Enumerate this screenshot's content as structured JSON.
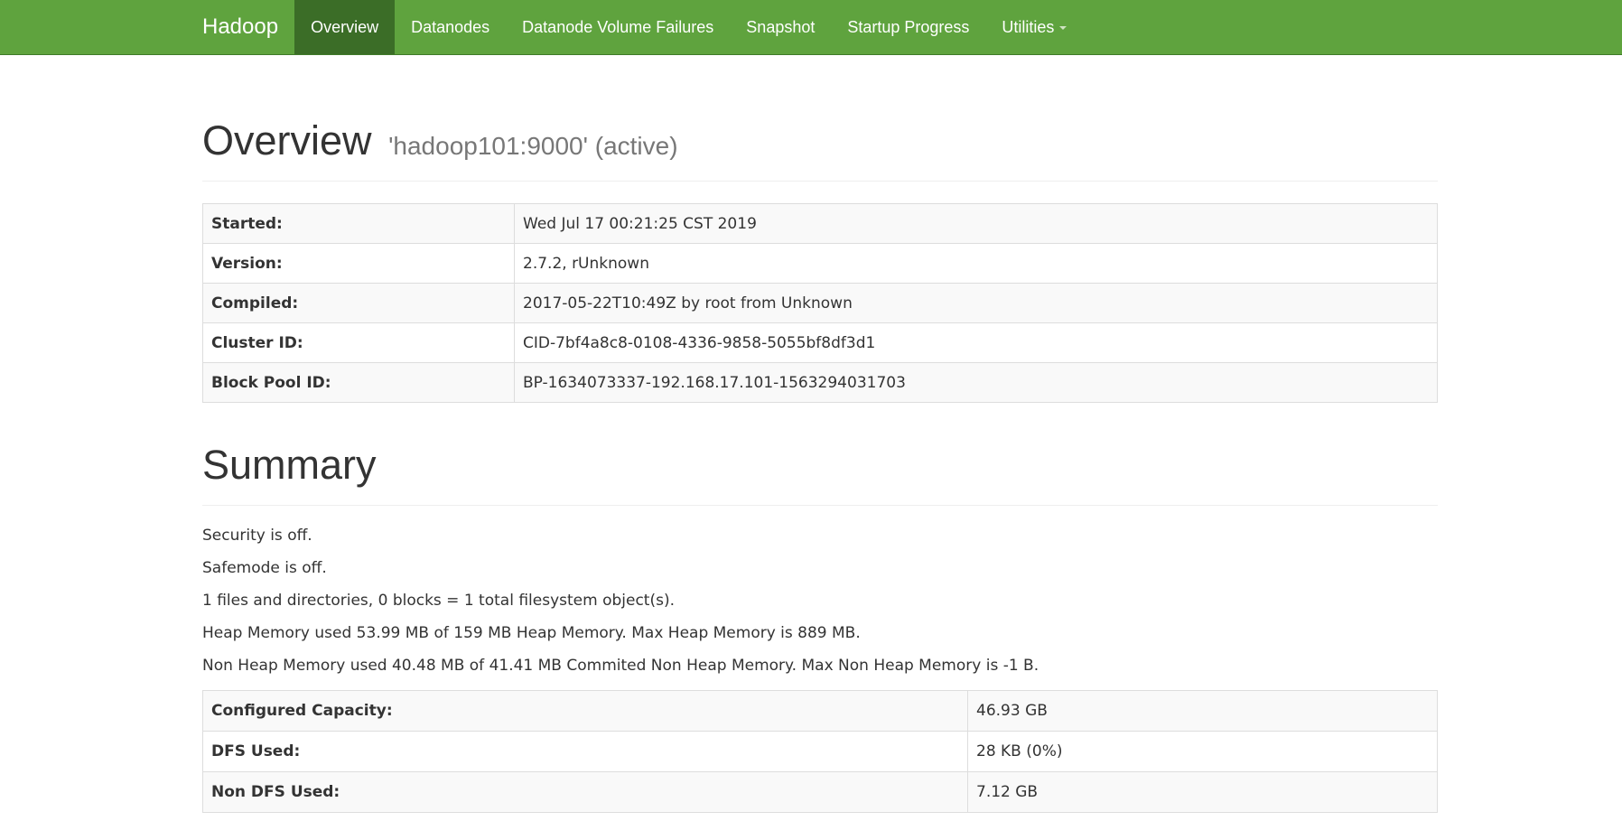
{
  "navbar": {
    "brand": "Hadoop",
    "items": [
      {
        "label": "Overview",
        "active": true
      },
      {
        "label": "Datanodes",
        "active": false
      },
      {
        "label": "Datanode Volume Failures",
        "active": false
      },
      {
        "label": "Snapshot",
        "active": false
      },
      {
        "label": "Startup Progress",
        "active": false
      },
      {
        "label": "Utilities",
        "active": false,
        "dropdown": true
      }
    ],
    "color": "#5fa33e",
    "active_color": "#3b6d27"
  },
  "overview": {
    "title": "Overview",
    "subtitle": "'hadoop101:9000' (active)",
    "rows": [
      {
        "label": "Started:",
        "value": "Wed Jul 17 00:21:25 CST 2019"
      },
      {
        "label": "Version:",
        "value": "2.7.2, rUnknown"
      },
      {
        "label": "Compiled:",
        "value": "2017-05-22T10:49Z by root from Unknown"
      },
      {
        "label": "Cluster ID:",
        "value": "CID-7bf4a8c8-0108-4336-9858-5055bf8df3d1"
      },
      {
        "label": "Block Pool ID:",
        "value": "BP-1634073337-192.168.17.101-1563294031703"
      }
    ]
  },
  "summary": {
    "title": "Summary",
    "lines": [
      "Security is off.",
      "Safemode is off.",
      "1 files and directories, 0 blocks = 1 total filesystem object(s).",
      "Heap Memory used 53.99 MB of 159 MB Heap Memory. Max Heap Memory is 889 MB.",
      "Non Heap Memory used 40.48 MB of 41.41 MB Commited Non Heap Memory. Max Non Heap Memory is -1 B."
    ],
    "rows": [
      {
        "label": "Configured Capacity:",
        "value": "46.93 GB"
      },
      {
        "label": "DFS Used:",
        "value": "28 KB (0%)"
      },
      {
        "label": "Non DFS Used:",
        "value": "7.12 GB"
      }
    ]
  }
}
